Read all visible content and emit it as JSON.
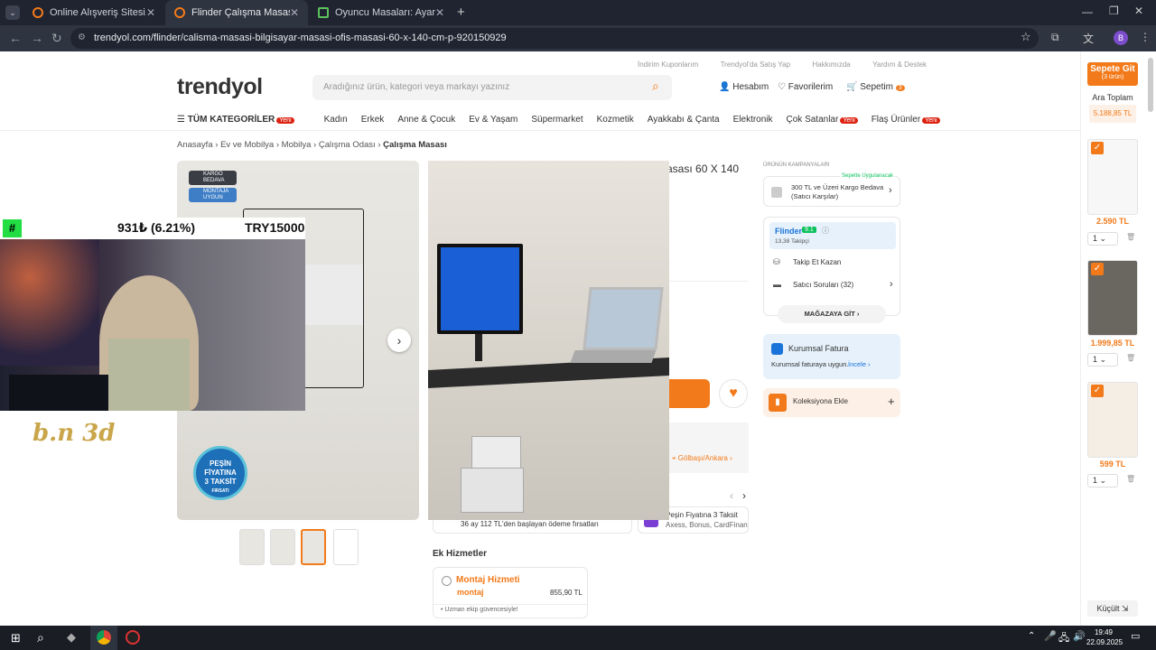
{
  "browser": {
    "tabs": [
      {
        "title": "Online Alışveriş Sitesi, Türkiye'n"
      },
      {
        "title": "Flinder Çalışma Masası Bilgisay"
      },
      {
        "title": "Oyuncu Masaları: Ayarlanabili"
      }
    ],
    "url": "trendyol.com/flinder/calisma-masasi-bilgisayar-masasi-ofis-masasi-60-x-140-cm-p-920150929",
    "profile": "B"
  },
  "header": {
    "toplinks": [
      "İndirim Kuponlarım",
      "Trendyol'da Satış Yap",
      "Hakkımızda",
      "Yardım & Destek"
    ],
    "logo": "trendyol",
    "search_placeholder": "Aradığınız ürün, kategori veya markayı yazınız",
    "account": "Hesabım",
    "favorites": "Favorilerim",
    "cart": "Sepetim",
    "cart_count": "3"
  },
  "nav": {
    "all": "TÜM KATEGORİLER",
    "yeni": "Yeni",
    "items": [
      "Kadın",
      "Erkek",
      "Anne & Çocuk",
      "Ev & Yaşam",
      "Süpermarket",
      "Kozmetik",
      "Ayakkabı & Çanta",
      "Elektronik",
      "Çok Satanlar",
      "Flaş Ürünler"
    ]
  },
  "breadcrumb": [
    "Anasayfa",
    "Ev ve Mobilya",
    "Mobilya",
    "Çalışma Odası",
    "Çalışma Masası"
  ],
  "product": {
    "title_fragment": "asası 60 X 140",
    "badge_cargo": "KARGO BEDAVA",
    "badge_montaj": "MONTAJA UYGUN",
    "pesin": [
      "PEŞİN",
      "FİYATINA",
      "3 TAKSİT",
      "FIRSATI"
    ],
    "location": "Gölbaşı/Ankara",
    "taksit1": "36 ay 112 TL'den başlayan ödeme fırsatları",
    "taksit2_title": "Peşin Fiyatına 3 Taksit",
    "taksit2_sub": "Axess, Bonus, CardFinans"
  },
  "services": {
    "title": "Ek Hizmetler",
    "montaj_title": "Montaj Hizmeti",
    "montaj_brand": "montaj",
    "montaj_price": "855,90 TL",
    "montaj_note": "• Uzman ekip güvencesiyle!"
  },
  "campaigns": {
    "title": "ÜRÜNÜN KAMPANYALARI",
    "tag": "Sepette Uygulanacak",
    "cargo": "300 TL ve Üzeri Kargo Bedava (Satıcı Karşılar)"
  },
  "seller": {
    "name": "Flinder",
    "score": "9.1",
    "followers": "13,38 Takipçi",
    "follow": "Takip Et Kazan",
    "questions": "Satıcı Soruları (32)",
    "store": "MAĞAZAYA GİT"
  },
  "invoice": {
    "title": "Kurumsal Fatura",
    "text": "Kurumsal faturaya uygun.",
    "link": "İncele"
  },
  "collection": {
    "label": "Koleksiyona Ekle"
  },
  "overlay": {
    "hash": "#",
    "donation": "931₺ (6.21%)",
    "goal": "TRY15000",
    "watermark": "b.n 3d"
  },
  "sidecart": {
    "button": "Sepete Git",
    "count": "(3 ürün)",
    "subtotal_label": "Ara Toplam",
    "subtotal": "5.188,85 TL",
    "items": [
      {
        "price": "2.590 TL",
        "qty": "1"
      },
      {
        "price": "1.999,85 TL",
        "qty": "1"
      },
      {
        "price": "599 TL",
        "qty": "1"
      }
    ],
    "shrink": "Küçült"
  },
  "taskbar": {
    "time": "19:49",
    "date": "22.09.2025"
  }
}
